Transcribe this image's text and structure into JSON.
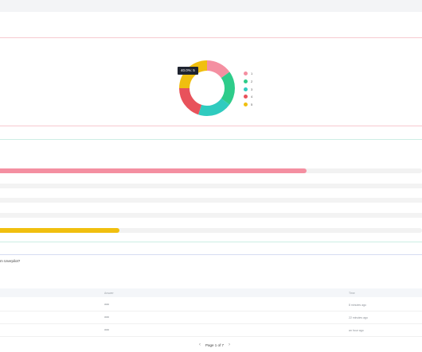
{
  "chart_data": {
    "type": "pie",
    "donut": true,
    "categories": [
      "1",
      "2",
      "3",
      "4",
      "5"
    ],
    "values": [
      15,
      20,
      20,
      19.9,
      25
    ],
    "colors": [
      "#f48fa1",
      "#2ecc8a",
      "#2fcbbf",
      "#e8525b",
      "#f0bf0f"
    ],
    "tooltip": "40.0%: 5",
    "legend_position": "right"
  },
  "progress": {
    "top_color": "#f48fa1",
    "top_fraction": 0.727,
    "bottom_color": "#f0bf0f",
    "bottom_fraction": 0.283
  },
  "question_text": "m Userpilot?",
  "table": {
    "headers": [
      "Answer",
      "Time"
    ],
    "rows": [
      {
        "answer": "aaa",
        "time": "8 minutes ago"
      },
      {
        "answer": "aaa",
        "time": "22 minutes ago"
      },
      {
        "answer": "aaa",
        "time": "an hour ago"
      }
    ]
  },
  "pagination": {
    "label": "Page 1 of 7",
    "prev": "‹",
    "next": "›"
  },
  "colors": {
    "pink_line": "#f7c9cf",
    "teal_line": "#cdeee4",
    "blue_line": "#d6dcf2"
  }
}
